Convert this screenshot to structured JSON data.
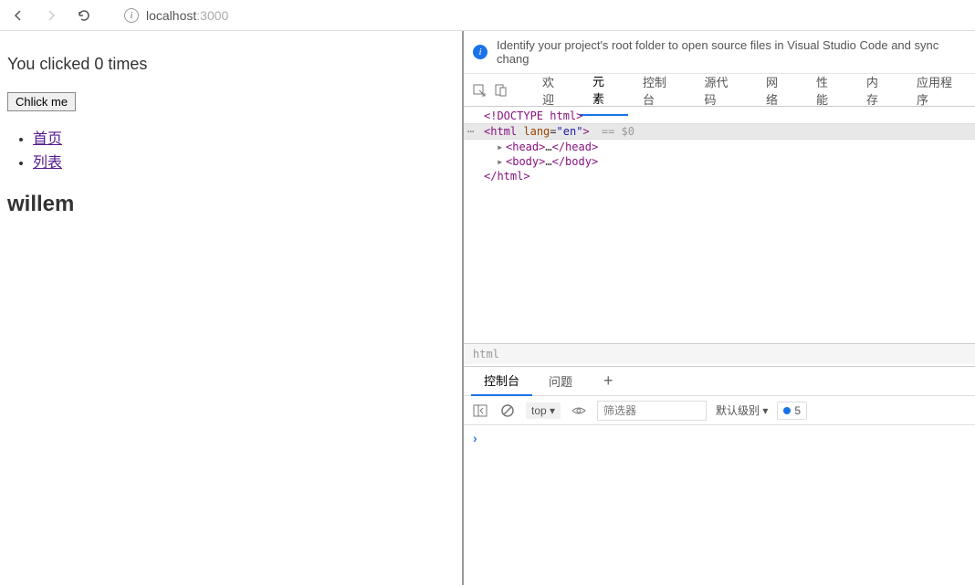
{
  "browser": {
    "url_host": "localhost",
    "url_port": ":3000"
  },
  "page": {
    "click_text": "You clicked 0 times",
    "button_label": "Chlick me",
    "links": [
      "首页",
      "列表"
    ],
    "heading": "willem"
  },
  "devtools": {
    "info_message": "Identify your project's root folder to open source files in Visual Studio Code and sync chang",
    "tabs": [
      "欢迎",
      "元素",
      "控制台",
      "源代码",
      "网络",
      "性能",
      "内存",
      "应用程序"
    ],
    "active_tab": "元素",
    "dom": {
      "doctype": "<!DOCTYPE html>",
      "html_open": "<",
      "html_tag": "html",
      "lang_attr": "lang",
      "lang_val": "\"en\"",
      "html_close": ">",
      "sel_marker": " == $0",
      "head": {
        "open": "<head>",
        "dots": "…",
        "close": "</head>"
      },
      "body": {
        "open": "<body>",
        "dots": "…",
        "close": "</body>"
      },
      "html_end": "</html>"
    },
    "breadcrumb": "html",
    "drawer_tabs": [
      "控制台",
      "问题"
    ],
    "drawer_active": "控制台",
    "console": {
      "context": "top ▾",
      "filter_placeholder": "筛选器",
      "levels": "默认级别 ▾",
      "badge_count": "5"
    }
  }
}
